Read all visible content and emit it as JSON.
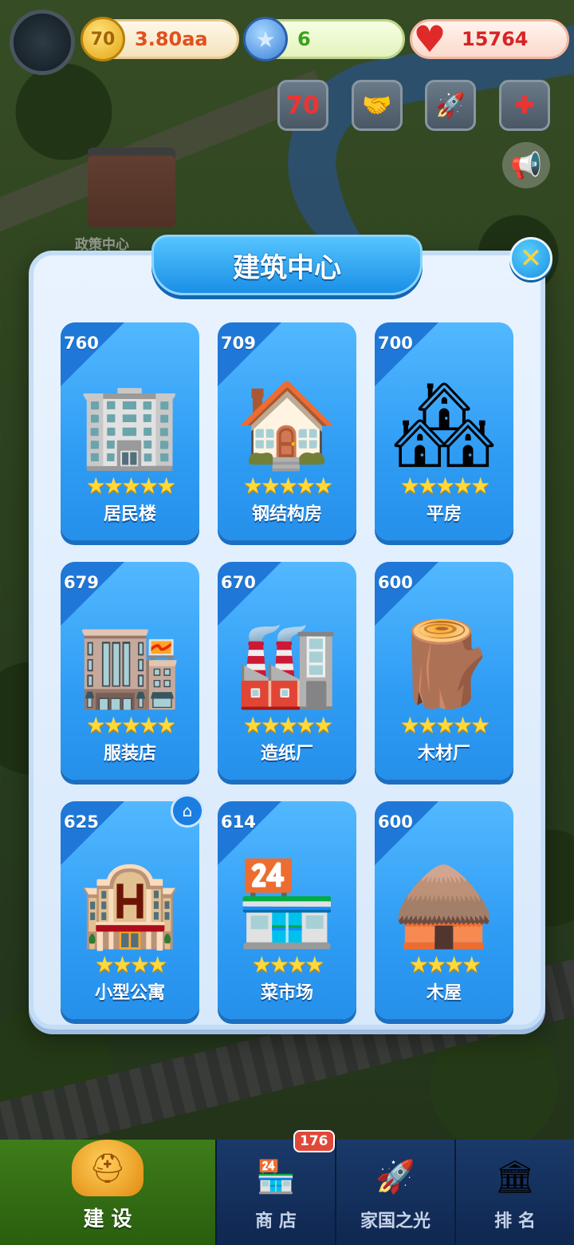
{
  "hud": {
    "coins": "3.80aa",
    "coin_icon_text": "70",
    "gems": "6",
    "hearts": "15764",
    "quick_buttons": [
      {
        "icon": "anniversary-70-icon",
        "glyph": "70"
      },
      {
        "icon": "handshake-icon",
        "glyph": "🤝"
      },
      {
        "icon": "rocket-event-icon",
        "glyph": "🚀"
      },
      {
        "icon": "medical-kit-icon",
        "glyph": "✚"
      }
    ],
    "speaker_icon": "announcement-speaker-icon"
  },
  "background": {
    "building_label": "政策中心"
  },
  "modal": {
    "title": "建筑中心",
    "close_glyph": "✕",
    "cards": [
      {
        "num": "760",
        "name": "居民楼",
        "stars": 5,
        "glyph": "🏢"
      },
      {
        "num": "709",
        "name": "钢结构房",
        "stars": 5,
        "glyph": "🏠"
      },
      {
        "num": "700",
        "name": "平房",
        "stars": 5,
        "glyph": "🏘"
      },
      {
        "num": "679",
        "name": "服装店",
        "stars": 5,
        "glyph": "🏬"
      },
      {
        "num": "670",
        "name": "造纸厂",
        "stars": 5,
        "glyph": "🏭"
      },
      {
        "num": "600",
        "name": "木材厂",
        "stars": 5,
        "glyph": "🪵"
      },
      {
        "num": "625",
        "name": "小型公寓",
        "stars": 4,
        "glyph": "🏨"
      },
      {
        "num": "614",
        "name": "菜市场",
        "stars": 4,
        "glyph": "🏪"
      },
      {
        "num": "600",
        "name": "木屋",
        "stars": 4,
        "glyph": "🛖"
      }
    ],
    "home_badge_glyph": "⌂"
  },
  "nav": {
    "tabs": [
      {
        "label": "建 设",
        "icon": "hard-hat-icon",
        "glyph": "⛑",
        "active": true
      },
      {
        "label": "商 店",
        "icon": "shop-icon",
        "glyph": "🏪",
        "badge": "176"
      },
      {
        "label": "家国之光",
        "icon": "rocket-icon",
        "glyph": "🚀"
      },
      {
        "label": "排 名",
        "icon": "ranking-icon",
        "glyph": "🏛"
      }
    ]
  },
  "colors": {
    "card_blue": "#2f9cf4",
    "star_yellow": "#ffd83a",
    "coin_text": "#e0501f",
    "gem_text": "#3aa21a",
    "heart_text": "#d62424"
  }
}
